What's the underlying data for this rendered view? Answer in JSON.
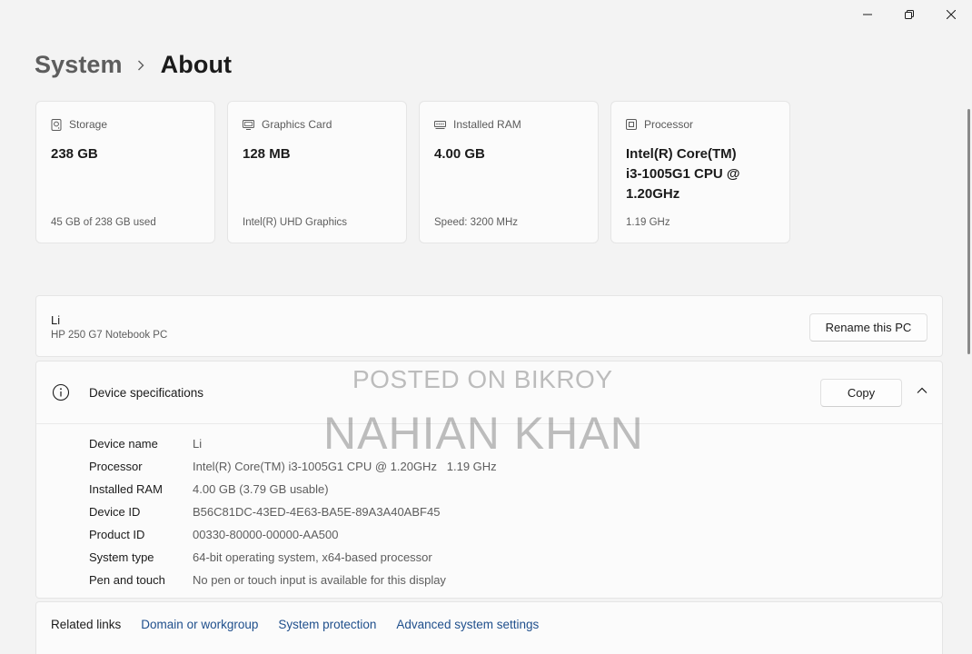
{
  "breadcrumb": {
    "parent": "System",
    "current": "About"
  },
  "cards": [
    {
      "icon": "storage-icon",
      "label": "Storage",
      "value": "238 GB",
      "sub": "45 GB of 238 GB used"
    },
    {
      "icon": "graphics-card-icon",
      "label": "Graphics Card",
      "value": "128 MB",
      "sub": "Intel(R) UHD Graphics"
    },
    {
      "icon": "ram-icon",
      "label": "Installed RAM",
      "value": "4.00 GB",
      "sub": "Speed: 3200 MHz"
    },
    {
      "icon": "processor-icon",
      "label": "Processor",
      "value_lines": [
        "Intel(R) Core(TM)",
        "i3-1005G1 CPU @",
        "1.20GHz"
      ],
      "sub": "1.19 GHz"
    }
  ],
  "pc": {
    "name": "Li",
    "model": "HP 250 G7 Notebook PC",
    "rename_label": "Rename this PC"
  },
  "specs": {
    "title": "Device specifications",
    "copy_label": "Copy",
    "rows": [
      {
        "label": "Device name",
        "value": "Li"
      },
      {
        "label": "Processor",
        "value": "Intel(R) Core(TM) i3-1005G1 CPU @ 1.20GHz   1.19 GHz"
      },
      {
        "label": "Installed RAM",
        "value": "4.00 GB (3.79 GB usable)"
      },
      {
        "label": "Device ID",
        "value": "B56C81DC-43ED-4E63-BA5E-89A3A40ABF45"
      },
      {
        "label": "Product ID",
        "value": "00330-80000-00000-AA500"
      },
      {
        "label": "System type",
        "value": "64-bit operating system, x64-based processor"
      },
      {
        "label": "Pen and touch",
        "value": "No pen or touch input is available for this display"
      }
    ]
  },
  "related": {
    "label": "Related links",
    "links": [
      "Domain or workgroup",
      "System protection",
      "Advanced system settings"
    ]
  },
  "watermark": {
    "line1": "POSTED ON BIKROY",
    "line2": "NAHIAN KHAN"
  },
  "colors": {
    "link": "#1f4f8c",
    "background": "#f3f3f3",
    "card": "#fbfbfb"
  }
}
